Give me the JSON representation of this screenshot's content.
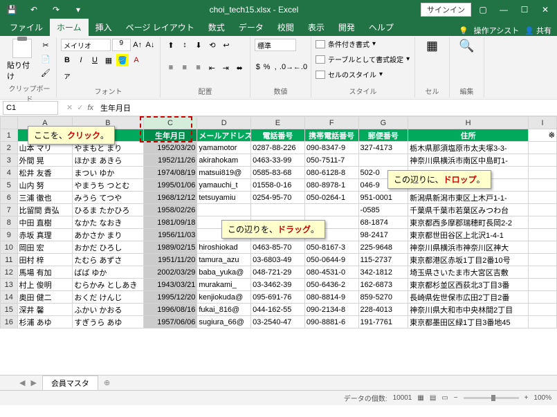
{
  "app": {
    "title": "choi_tech15.xlsx - Excel",
    "signin": "サインイン"
  },
  "tabs": [
    "ファイル",
    "ホーム",
    "挿入",
    "ページ レイアウト",
    "数式",
    "データ",
    "校閲",
    "表示",
    "開発",
    "ヘルプ"
  ],
  "ribbon": {
    "tell_me": "操作アシスト",
    "share": "共有",
    "paste": "貼り付け",
    "clipboard_label": "クリップボード",
    "font_name": "メイリオ",
    "font_size": "9",
    "font_label": "フォント",
    "align_label": "配置",
    "num_format": "標準",
    "num_label": "数値",
    "cond_fmt": "条件付き書式",
    "table_fmt": "テーブルとして書式設定",
    "cell_style": "セルのスタイル",
    "style_label": "スタイル",
    "cell_label": "セル",
    "edit_label": "編集"
  },
  "namebox": "C1",
  "formula": "生年月日",
  "columns": [
    "A",
    "B",
    "C",
    "D",
    "E",
    "F",
    "G",
    "H",
    "I"
  ],
  "headers": [
    "",
    "",
    "生年月日",
    "メールアドレス",
    "電話番号",
    "携帯電話番号",
    "郵便番号",
    "住所",
    ""
  ],
  "rows": [
    {
      "n": 2,
      "a": "山本 マリ",
      "b": "やまもと まり",
      "c": "1952/03/20",
      "d": "yamamotor",
      "e": "0287-88-226",
      "f": "090-8347-9",
      "g": "327-4173",
      "h": "栃木県那須塩原市太夫塚3-3-"
    },
    {
      "n": 3,
      "a": "外間 晃",
      "b": "ほかま あきら",
      "c": "1952/11/26",
      "d": "akirahokam",
      "e": "0463-33-99",
      "f": "050-7511-7",
      "g": "",
      "h": "神奈川県横浜市南区中島町1-"
    },
    {
      "n": 4,
      "a": "松井 友香",
      "b": "まつい ゆか",
      "c": "1974/08/19",
      "d": "matsui819@",
      "e": "0585-83-68",
      "f": "080-6128-8",
      "g": "502-0",
      "h": ""
    },
    {
      "n": 5,
      "a": "山内 努",
      "b": "やまうち つとむ",
      "c": "1995/01/06",
      "d": "yamauchi_t",
      "e": "01558-0-16",
      "f": "080-8978-1",
      "g": "046-9",
      "h": ""
    },
    {
      "n": 6,
      "a": "三浦 徹也",
      "b": "みうら てつや",
      "c": "1968/12/12",
      "d": "tetsuyamiu",
      "e": "0254-95-70",
      "f": "050-0264-1",
      "g": "951-0001",
      "h": "新潟県新潟市東区上木戸1-1-"
    },
    {
      "n": 7,
      "a": "比留間 貴弘",
      "b": "ひるま たかひろ",
      "c": "1958/02/26",
      "d": "",
      "e": "",
      "f": "",
      "g": "-0585",
      "h": "千葉県千葉市若葉区みつわ台"
    },
    {
      "n": 8,
      "a": "中田 直樹",
      "b": "なかた なおき",
      "c": "1981/09/18",
      "d": "",
      "e": "",
      "f": "",
      "g": "68-1874",
      "h": "東京都西多摩郡瑞穂町長岡2-2"
    },
    {
      "n": 9,
      "a": "赤坂 真理",
      "b": "あかさか まり",
      "c": "1956/11/03",
      "d": "",
      "e": "",
      "f": "",
      "g": "98-2417",
      "h": "東京都世田谷区上北沢1-4-1"
    },
    {
      "n": 10,
      "a": "岡田 宏",
      "b": "おかだ ひろし",
      "c": "1989/02/15",
      "d": "hiroshiokad",
      "e": "0463-85-70",
      "f": "050-8167-3",
      "g": "225-9648",
      "h": "神奈川県横浜市神奈川区神大"
    },
    {
      "n": 11,
      "a": "田村 梓",
      "b": "たむら あずさ",
      "c": "1951/11/20",
      "d": "tamura_azu",
      "e": "03-6803-49",
      "f": "050-0644-9",
      "g": "115-2737",
      "h": "東京都港区赤坂1丁目2番10号"
    },
    {
      "n": 12,
      "a": "馬場 有加",
      "b": "ばば ゆか",
      "c": "2002/03/29",
      "d": "baba_yuka@",
      "e": "048-721-29",
      "f": "080-4531-0",
      "g": "342-1812",
      "h": "埼玉県さいたま市大宮区吉敷"
    },
    {
      "n": 13,
      "a": "村上 俊明",
      "b": "むらかみ としあき",
      "c": "1943/03/21",
      "d": "murakami_",
      "e": "03-3462-39",
      "f": "050-6436-2",
      "g": "162-6873",
      "h": "東京都杉並区西荻北3丁目3番"
    },
    {
      "n": 14,
      "a": "奥田 健二",
      "b": "おくだ けんじ",
      "c": "1995/12/20",
      "d": "kenjiokuda@",
      "e": "095-691-76",
      "f": "080-8814-9",
      "g": "859-5270",
      "h": "長崎県佐世保市広田2丁目2番"
    },
    {
      "n": 15,
      "a": "深井 馨",
      "b": "ふかい かおる",
      "c": "1996/08/16",
      "d": "fukai_816@",
      "e": "044-162-55",
      "f": "090-2134-8",
      "g": "228-4013",
      "h": "神奈川県大和市中央林間2丁目"
    },
    {
      "n": 16,
      "a": "杉浦 あゆ",
      "b": "すぎうら あゆ",
      "c": "1957/06/06",
      "d": "sugiura_66@",
      "e": "03-2540-47",
      "f": "090-8881-6",
      "g": "191-7761",
      "h": "東京都墨田区緑1丁目3番地45"
    }
  ],
  "callouts": {
    "click": {
      "pre": "ここを",
      "em": "クリック"
    },
    "drop": {
      "pre": "この辺りに",
      "em": "ドロップ"
    },
    "drag": {
      "pre": "この辺りを",
      "em": "ドラッグ"
    }
  },
  "sheet": "会員マスタ",
  "status": {
    "count_label": "データの個数:",
    "count": "10001",
    "zoom": "100%"
  },
  "chart_data": null
}
